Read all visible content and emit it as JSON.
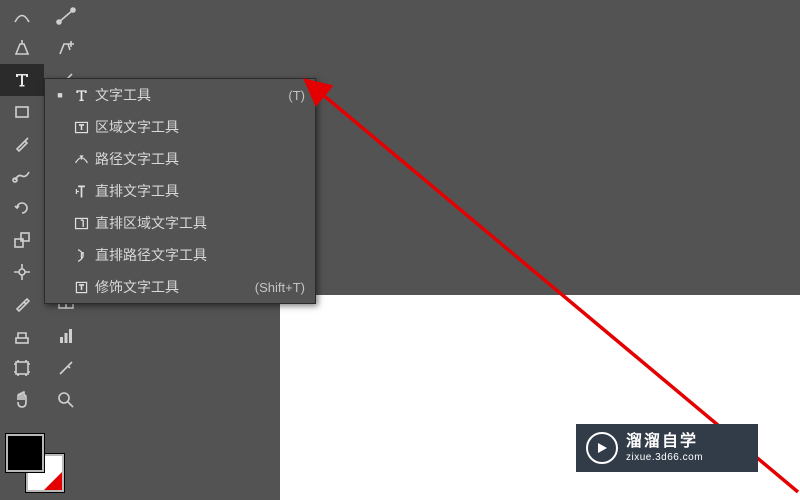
{
  "toolbar": {
    "rows": [
      [
        "curvature-icon",
        "anchor-icon"
      ],
      [
        "pen-icon",
        "pen-add-icon"
      ],
      [
        "type-icon",
        "line-segment-icon"
      ],
      [
        "rectangle-icon",
        "arc-icon"
      ],
      [
        "paintbrush-icon",
        "pencil-icon"
      ],
      [
        "scissors-icon",
        "blob-icon"
      ],
      [
        "rotate-icon",
        "mirror-icon"
      ],
      [
        "scale-icon",
        "transform-icon"
      ],
      [
        "width-icon",
        "warp-icon"
      ],
      [
        "eyedropper-icon",
        "blend-icon"
      ],
      [
        "stack-icon",
        "graph-icon"
      ],
      [
        "artboard-icon",
        "slice-icon"
      ],
      [
        "hand-icon",
        "zoom-icon"
      ]
    ]
  },
  "flyout": {
    "items": [
      {
        "icon": "type-icon",
        "label": "文字工具",
        "shortcut": "(T)",
        "selected": true
      },
      {
        "icon": "area-type-icon",
        "label": "区域文字工具",
        "shortcut": "",
        "selected": false
      },
      {
        "icon": "path-type-icon",
        "label": "路径文字工具",
        "shortcut": "",
        "selected": false
      },
      {
        "icon": "vertical-type-icon",
        "label": "直排文字工具",
        "shortcut": "",
        "selected": false
      },
      {
        "icon": "vertical-area-type-icon",
        "label": "直排区域文字工具",
        "shortcut": "",
        "selected": false
      },
      {
        "icon": "vertical-path-type-icon",
        "label": "直排路径文字工具",
        "shortcut": "",
        "selected": false
      },
      {
        "icon": "touch-type-icon",
        "label": "修饰文字工具",
        "shortcut": "(Shift+T)",
        "selected": false
      }
    ]
  },
  "watermark": {
    "title": "溜溜自学",
    "url": "zixue.3d66.com"
  }
}
